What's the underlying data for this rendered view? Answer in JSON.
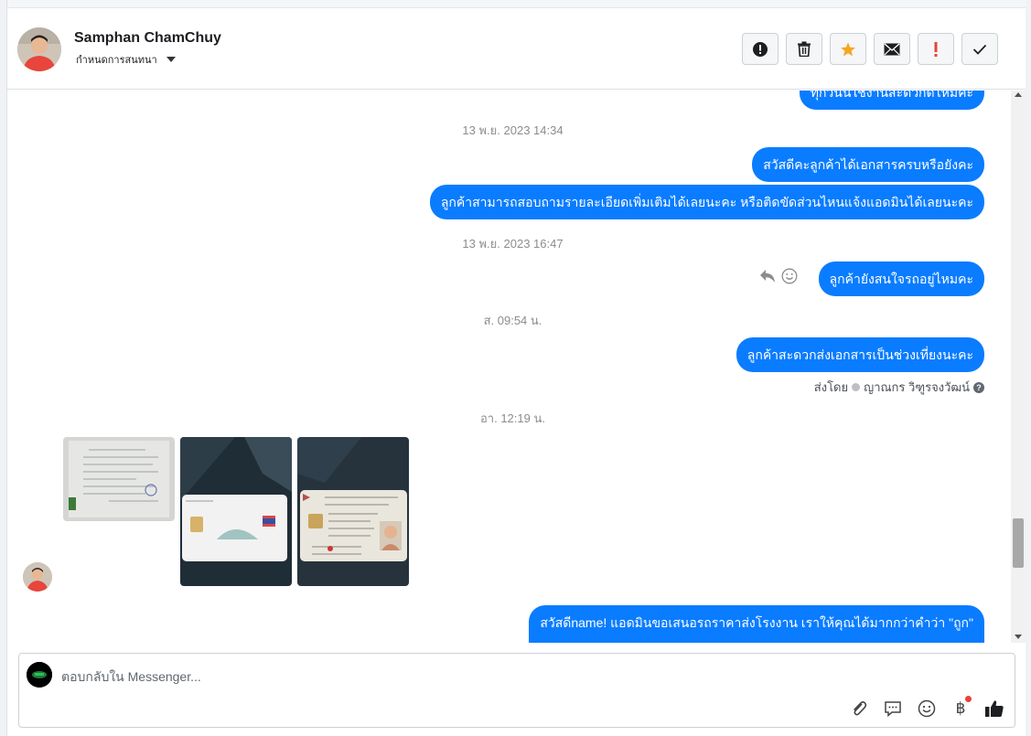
{
  "header": {
    "contact_name": "Samphan ChamChuy",
    "conversation_label": "กำหนดการสนทนา",
    "actions": [
      {
        "name": "spam-button",
        "icon": "exclamation-circle-icon"
      },
      {
        "name": "delete-button",
        "icon": "trash-icon"
      },
      {
        "name": "star-button",
        "icon": "star-icon",
        "color": "#f5a623"
      },
      {
        "name": "mark-unread-button",
        "icon": "envelope-icon"
      },
      {
        "name": "important-button",
        "icon": "exclamation-icon",
        "color": "#e4453a"
      },
      {
        "name": "mark-done-button",
        "icon": "check-icon"
      }
    ]
  },
  "messages": {
    "top_partial": "ทุกวันนี้ใช้งานสะดวกดีไหมค่ะ",
    "ts1": "13 พ.ย. 2023 14:34",
    "msg1": "สวัสดีคะลูกค้าได้เอกสารครบหรือยังคะ",
    "msg2": "ลูกค้าสามารถสอบถามรายละเอียดเพิ่มเติมได้เลยนะคะ หรือติดขัดส่วนไหนแจ้งแอดมินได้เลยนะคะ",
    "ts2": "13 พ.ย. 2023 16:47",
    "msg3": "ลูกค้ายังสนใจรถอยู่ไหมคะ",
    "ts3": "ส. 09:54 น.",
    "msg4": "ลูกค้าสะดวกส่งเอกสารเป็นช่วงเที่ยงนะคะ",
    "sent_by_label": "ส่งโดย",
    "sent_by_name": "ญาณกร วิฑูรจงวัฒน์",
    "ts4": "อา. 12:19 น.",
    "msg5": "สวัสดีname! แอดมินขอเสนอรถราคาส่งโรงงาน เราให้คุณได้มากกว่าคำว่า \"ถูก\""
  },
  "colors": {
    "bubble": "#0a7cff",
    "timestamp": "#8a8d91"
  },
  "composer": {
    "placeholder": "ตอบกลับใน Messenger...",
    "baht_symbol": "฿"
  }
}
